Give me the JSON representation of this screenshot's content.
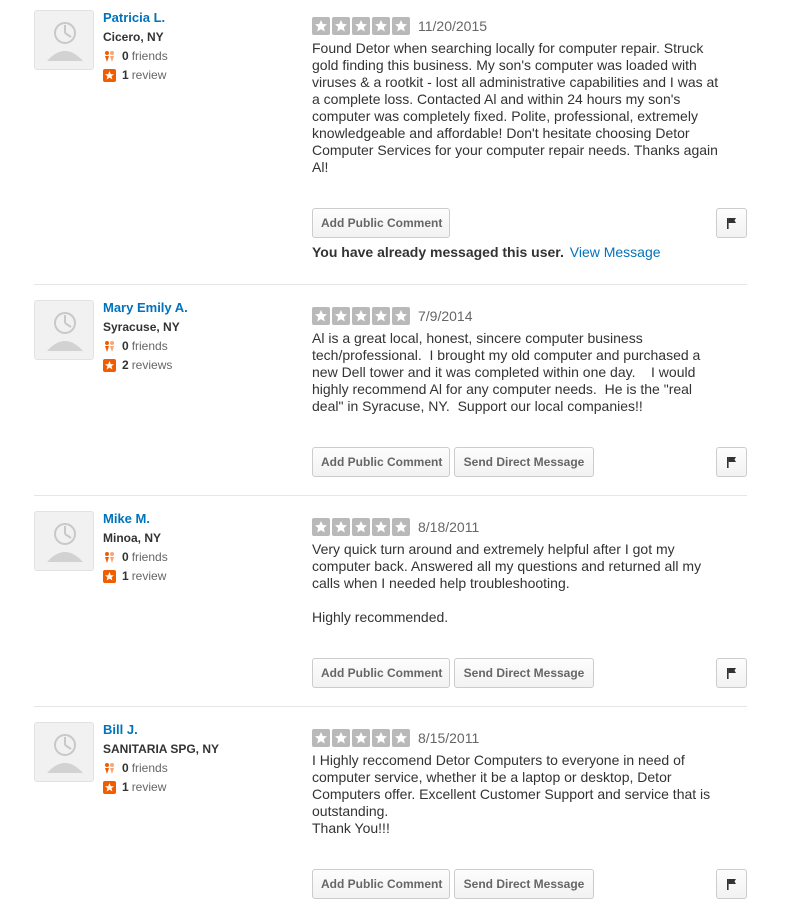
{
  "labels": {
    "friends_suffix": "friends",
    "review_singular": "review",
    "review_plural": "reviews",
    "add_comment": "Add Public Comment",
    "send_message": "Send Direct Message",
    "already_messaged": "You have already messaged this user.",
    "view_message": "View Message"
  },
  "colors": {
    "link": "#0073bb",
    "star_gray": "#b9b9b9",
    "friends_orange": "#f15c00",
    "review_badge": "#f15c00"
  },
  "icons": {
    "avatar": "default-avatar-icon",
    "friends": "friends-icon",
    "review": "review-star-badge-icon",
    "star": "star-icon",
    "flag": "flag-icon"
  },
  "reviews": [
    {
      "name": "Patricia L.",
      "location": "Cicero, NY",
      "friends": "0",
      "reviews_count": "1",
      "reviews_label": "review",
      "rating": 5,
      "date": "11/20/2015",
      "text": "Found Detor when searching locally for computer repair. Struck gold finding this business. My son's computer was loaded with viruses & a rootkit - lost all administrative capabilities and I was at a complete loss. Contacted Al and within 24 hours my son's computer was completely fixed. Polite, professional, extremely knowledgeable and affordable! Don't hesitate choosing Detor Computer Services for your computer repair needs. Thanks again Al!",
      "already_messaged": true
    },
    {
      "name": "Mary Emily A.",
      "location": "Syracuse, NY",
      "friends": "0",
      "reviews_count": "2",
      "reviews_label": "reviews",
      "rating": 5,
      "date": "7/9/2014",
      "text": "Al is a great local, honest, sincere computer business tech/professional.  I brought my old computer and purchased a new Dell tower and it was completed within one day.    I would highly recommend Al for any computer needs.  He is the \"real deal\" in Syracuse, NY.  Support our local companies!!",
      "already_messaged": false
    },
    {
      "name": "Mike M.",
      "location": "Minoa, NY",
      "friends": "0",
      "reviews_count": "1",
      "reviews_label": "review",
      "rating": 5,
      "date": "8/18/2011",
      "text": "Very quick turn around and extremely helpful after I got my computer back. Answered all my questions and returned all my calls when I needed help troubleshooting.\n\nHighly recommended.",
      "already_messaged": false
    },
    {
      "name": "Bill J.",
      "location": "SANITARIA SPG, NY",
      "friends": "0",
      "reviews_count": "1",
      "reviews_label": "review",
      "rating": 5,
      "date": "8/15/2011",
      "text": "I Highly reccomend Detor Computers to everyone in need of computer service, whether it be a laptop or desktop, Detor Computers offer. Excellent Customer Support and service that is outstanding.\nThank You!!!",
      "already_messaged": false
    }
  ]
}
